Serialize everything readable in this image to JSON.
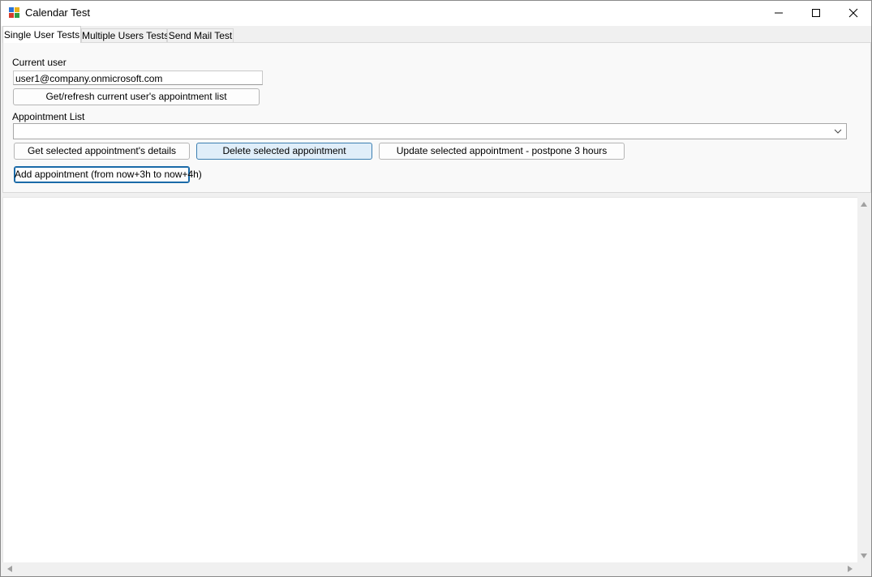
{
  "window": {
    "title": "Calendar Test",
    "app_icon": "calendar-app-icon",
    "controls": {
      "minimize": "minimize-icon",
      "maximize": "maximize-icon",
      "close": "close-icon"
    }
  },
  "tabs": [
    {
      "label": "Single User Tests",
      "active": true
    },
    {
      "label": "Multiple Users Tests",
      "active": false
    },
    {
      "label": "Send Mail Test",
      "active": false
    }
  ],
  "single_user": {
    "current_user_label": "Current user",
    "current_user_value": "user1@company.onmicrosoft.com",
    "refresh_button": "Get/refresh current user's appointment list",
    "appointment_list_label": "Appointment List",
    "appointment_list_value": "",
    "details_button": "Get selected appointment's details",
    "delete_button": "Delete selected appointment",
    "update_button": "Update selected appointment - postpone 3 hours",
    "add_button": "Add appointment (from now+3h to now+4h)"
  },
  "output": {
    "text": ""
  },
  "colors": {
    "window_bg": "#f0f0f0",
    "hover_button_bg": "#e0eef9",
    "hover_button_border": "#3c7fb1",
    "focus_border": "#1a6aa8"
  }
}
